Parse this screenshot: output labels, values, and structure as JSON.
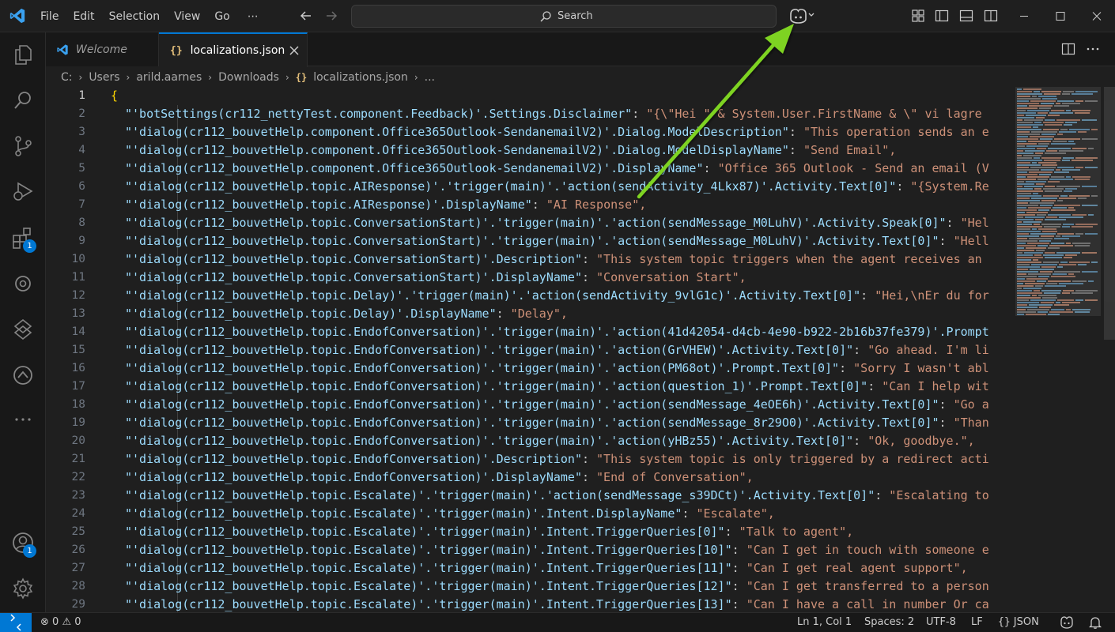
{
  "menu": [
    "File",
    "Edit",
    "Selection",
    "View",
    "Go",
    "⋯"
  ],
  "search": {
    "label": "Search"
  },
  "tabs": [
    {
      "label": "Welcome",
      "icon": "vscode-logo-icon"
    },
    {
      "label": "localizations.json",
      "icon": "json-icon",
      "close": "✕"
    }
  ],
  "breadcrumb": [
    "C:",
    "Users",
    "arild.aarnes",
    "Downloads",
    "localizations.json",
    "..."
  ],
  "editor": {
    "line_numbers": [
      "1",
      "2",
      "3",
      "4",
      "5",
      "6",
      "7",
      "8",
      "9",
      "10",
      "11",
      "12",
      "13",
      "14",
      "15",
      "16",
      "17",
      "18",
      "19",
      "20",
      "21",
      "22",
      "23",
      "24",
      "25",
      "26",
      "27",
      "28",
      "29"
    ],
    "lines": [
      {
        "key": "",
        "value": "",
        "brace": "{"
      },
      {
        "key": "\"'botSettings(cr112_nettyTest.component.Feedback)'.Settings.Disclaimer\"",
        "value": "\"{\\\"Hei \" & System.User.FirstName & \\\" vi lagre"
      },
      {
        "key": "\"'dialog(cr112_bouvetHelp.component.Office365Outlook-SendanemailV2)'.Dialog.ModelDescription\"",
        "value": "\"This operation sends an e"
      },
      {
        "key": "\"'dialog(cr112_bouvetHelp.component.Office365Outlook-SendanemailV2)'.Dialog.ModelDisplayName\"",
        "value": "\"Send Email\","
      },
      {
        "key": "\"'dialog(cr112_bouvetHelp.component.Office365Outlook-SendanemailV2)'.DisplayName\"",
        "value": "\"Office 365 Outlook - Send an email (V"
      },
      {
        "key": "\"'dialog(cr112_bouvetHelp.topic.AIResponse)'.'trigger(main)'.'action(sendActivity_4Lkx87)'.Activity.Text[0]\"",
        "value": "\"{System.Re"
      },
      {
        "key": "\"'dialog(cr112_bouvetHelp.topic.AIResponse)'.DisplayName\"",
        "value": "\"AI Response\","
      },
      {
        "key": "\"'dialog(cr112_bouvetHelp.topic.ConversationStart)'.'trigger(main)'.'action(sendMessage_M0LuhV)'.Activity.Speak[0]\"",
        "value": "\"Hel"
      },
      {
        "key": "\"'dialog(cr112_bouvetHelp.topic.ConversationStart)'.'trigger(main)'.'action(sendMessage_M0LuhV)'.Activity.Text[0]\"",
        "value": "\"Hell"
      },
      {
        "key": "\"'dialog(cr112_bouvetHelp.topic.ConversationStart)'.Description\"",
        "value": "\"This system topic triggers when the agent receives an"
      },
      {
        "key": "\"'dialog(cr112_bouvetHelp.topic.ConversationStart)'.DisplayName\"",
        "value": "\"Conversation Start\","
      },
      {
        "key": "\"'dialog(cr112_bouvetHelp.topic.Delay)'.'trigger(main)'.'action(sendActivity_9vlG1c)'.Activity.Text[0]\"",
        "value": "\"Hei,\\nEr du for"
      },
      {
        "key": "\"'dialog(cr112_bouvetHelp.topic.Delay)'.DisplayName\"",
        "value": "\"Delay\","
      },
      {
        "key": "\"'dialog(cr112_bouvetHelp.topic.EndofConversation)'.'trigger(main)'.'action(41d42054-d4cb-4e90-b922-2b16b37fe379)'.Prompt",
        "value": ""
      },
      {
        "key": "\"'dialog(cr112_bouvetHelp.topic.EndofConversation)'.'trigger(main)'.'action(GrVHEW)'.Activity.Text[0]\"",
        "value": "\"Go ahead. I'm li"
      },
      {
        "key": "\"'dialog(cr112_bouvetHelp.topic.EndofConversation)'.'trigger(main)'.'action(PM68ot)'.Prompt.Text[0]\"",
        "value": "\"Sorry I wasn't abl"
      },
      {
        "key": "\"'dialog(cr112_bouvetHelp.topic.EndofConversation)'.'trigger(main)'.'action(question_1)'.Prompt.Text[0]\"",
        "value": "\"Can I help wit"
      },
      {
        "key": "\"'dialog(cr112_bouvetHelp.topic.EndofConversation)'.'trigger(main)'.'action(sendMessage_4eOE6h)'.Activity.Text[0]\"",
        "value": "\"Go a"
      },
      {
        "key": "\"'dialog(cr112_bouvetHelp.topic.EndofConversation)'.'trigger(main)'.'action(sendMessage_8r29O0)'.Activity.Text[0]\"",
        "value": "\"Than"
      },
      {
        "key": "\"'dialog(cr112_bouvetHelp.topic.EndofConversation)'.'trigger(main)'.'action(yHBz55)'.Activity.Text[0]\"",
        "value": "\"Ok, goodbye.\","
      },
      {
        "key": "\"'dialog(cr112_bouvetHelp.topic.EndofConversation)'.Description\"",
        "value": "\"This system topic is only triggered by a redirect acti"
      },
      {
        "key": "\"'dialog(cr112_bouvetHelp.topic.EndofConversation)'.DisplayName\"",
        "value": "\"End of Conversation\","
      },
      {
        "key": "\"'dialog(cr112_bouvetHelp.topic.Escalate)'.'trigger(main)'.'action(sendMessage_s39DCt)'.Activity.Text[0]\"",
        "value": "\"Escalating to"
      },
      {
        "key": "\"'dialog(cr112_bouvetHelp.topic.Escalate)'.'trigger(main)'.Intent.DisplayName\"",
        "value": "\"Escalate\","
      },
      {
        "key": "\"'dialog(cr112_bouvetHelp.topic.Escalate)'.'trigger(main)'.Intent.TriggerQueries[0]\"",
        "value": "\"Talk to agent\","
      },
      {
        "key": "\"'dialog(cr112_bouvetHelp.topic.Escalate)'.'trigger(main)'.Intent.TriggerQueries[10]\"",
        "value": "\"Can I get in touch with someone e"
      },
      {
        "key": "\"'dialog(cr112_bouvetHelp.topic.Escalate)'.'trigger(main)'.Intent.TriggerQueries[11]\"",
        "value": "\"Can I get real agent support\","
      },
      {
        "key": "\"'dialog(cr112_bouvetHelp.topic.Escalate)'.'trigger(main)'.Intent.TriggerQueries[12]\"",
        "value": "\"Can I get transferred to a person"
      },
      {
        "key": "\"'dialog(cr112_bouvetHelp.topic.Escalate)'.'trigger(main)'.Intent.TriggerQueries[13]\"",
        "value": "\"Can I have a call in number Or ca"
      }
    ]
  },
  "status": {
    "errors": "0",
    "warnings": "0",
    "position": "Ln 1, Col 1",
    "spaces": "Spaces: 2",
    "encoding": "UTF-8",
    "eol": "LF",
    "language": "JSON"
  },
  "badges": {
    "extensions": "1",
    "accounts": "1"
  },
  "colors": {
    "accent": "#0078d4",
    "json_key": "#9cdcfe",
    "json_string": "#ce9178",
    "brace": "#ffd700",
    "annotation_arrow": "#7ed321"
  }
}
